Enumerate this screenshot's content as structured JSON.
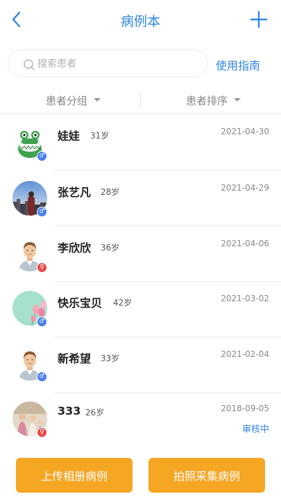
{
  "header": {
    "title": "病例本"
  },
  "search": {
    "placeholder": "搜索患者",
    "guide_label": "使用指南"
  },
  "filters": {
    "group_label": "患者分组",
    "sort_label": "患者排序"
  },
  "patients": [
    {
      "name": "娃娃",
      "age": "31岁",
      "date": "2021-04-30",
      "gender": "male",
      "gender_symbol": "♂",
      "avatar": "cartoon-crocodile-avatar",
      "status": ""
    },
    {
      "name": "张艺凡",
      "age": "28岁",
      "date": "2021-04-29",
      "gender": "male",
      "gender_symbol": "♂",
      "avatar": "city-sunset-photo-avatar",
      "status": ""
    },
    {
      "name": "李欣欣",
      "age": "36岁",
      "date": "2021-04-06",
      "gender": "female",
      "gender_symbol": "♀",
      "avatar": "default-man-avatar",
      "status": ""
    },
    {
      "name": "快乐宝贝",
      "age": "42岁",
      "date": "2021-03-02",
      "gender": "male",
      "gender_symbol": "♂",
      "avatar": "tulip-flowers-avatar",
      "status": ""
    },
    {
      "name": "新希望",
      "age": "33岁",
      "date": "2021-02-04",
      "gender": "male",
      "gender_symbol": "♂",
      "avatar": "default-man-avatar",
      "status": ""
    },
    {
      "name": "333",
      "age": "26岁",
      "date": "2018-09-05",
      "gender": "female",
      "gender_symbol": "♀",
      "avatar": "family-photo-avatar",
      "status": "审核中"
    }
  ],
  "actions": {
    "upload_album": "上传相册病例",
    "photo_collect": "拍照采集病例"
  },
  "colors": {
    "accent": "#2f86e6",
    "button": "#f5a623",
    "male": "#4a7ee8",
    "female": "#e84a4a"
  }
}
